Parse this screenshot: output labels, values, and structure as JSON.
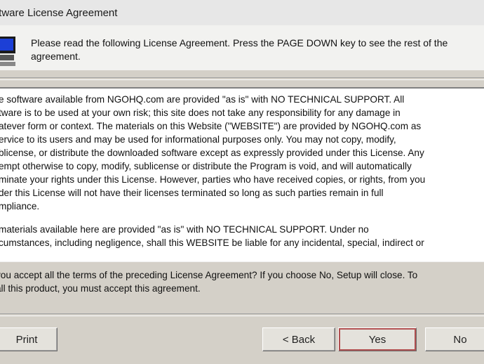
{
  "window": {
    "title": "ftware License Agreement"
  },
  "header": {
    "icon": "monitor-icon",
    "instructions": "Please read the following License Agreement. Press the PAGE DOWN key to see the rest of the\nagreement."
  },
  "license": {
    "paragraph1": "e software available from NGOHQ.com are provided \"as is\" with NO TECHNICAL SUPPORT. All\ntware is to be used at your own risk; this site does not take any responsibility for any damage in\natever form or context. The materials on this Website (\"WEBSITE\") are provided by NGOHQ.com as\nervice to its users and may be used for informational purposes only. You may not copy, modify,\nblicense, or distribute the downloaded software except as expressly provided under this License. Any\nempt otherwise to copy, modify, sublicense or distribute the Program is void, and will automatically\nminate your rights under this License. However, parties who have received copies, or rights, from you\nder this License will not have their licenses terminated so long as such parties remain in full\nmpliance.",
    "paragraph2": "materials available here are provided \"as is\" with NO TECHNICAL SUPPORT. Under no\ncumstances, including negligence, shall this WEBSITE be liable for any incidental, special, indirect or"
  },
  "question": "you accept all the terms of the preceding License Agreement? If you choose No, Setup will close. To\nall this product, you must accept this agreement.",
  "buttons": {
    "print": "Print",
    "back": "< Back",
    "yes": "Yes",
    "no": "No"
  },
  "colors": {
    "dialog_bg": "#d4d0c8",
    "focus_outline": "#b05050"
  }
}
